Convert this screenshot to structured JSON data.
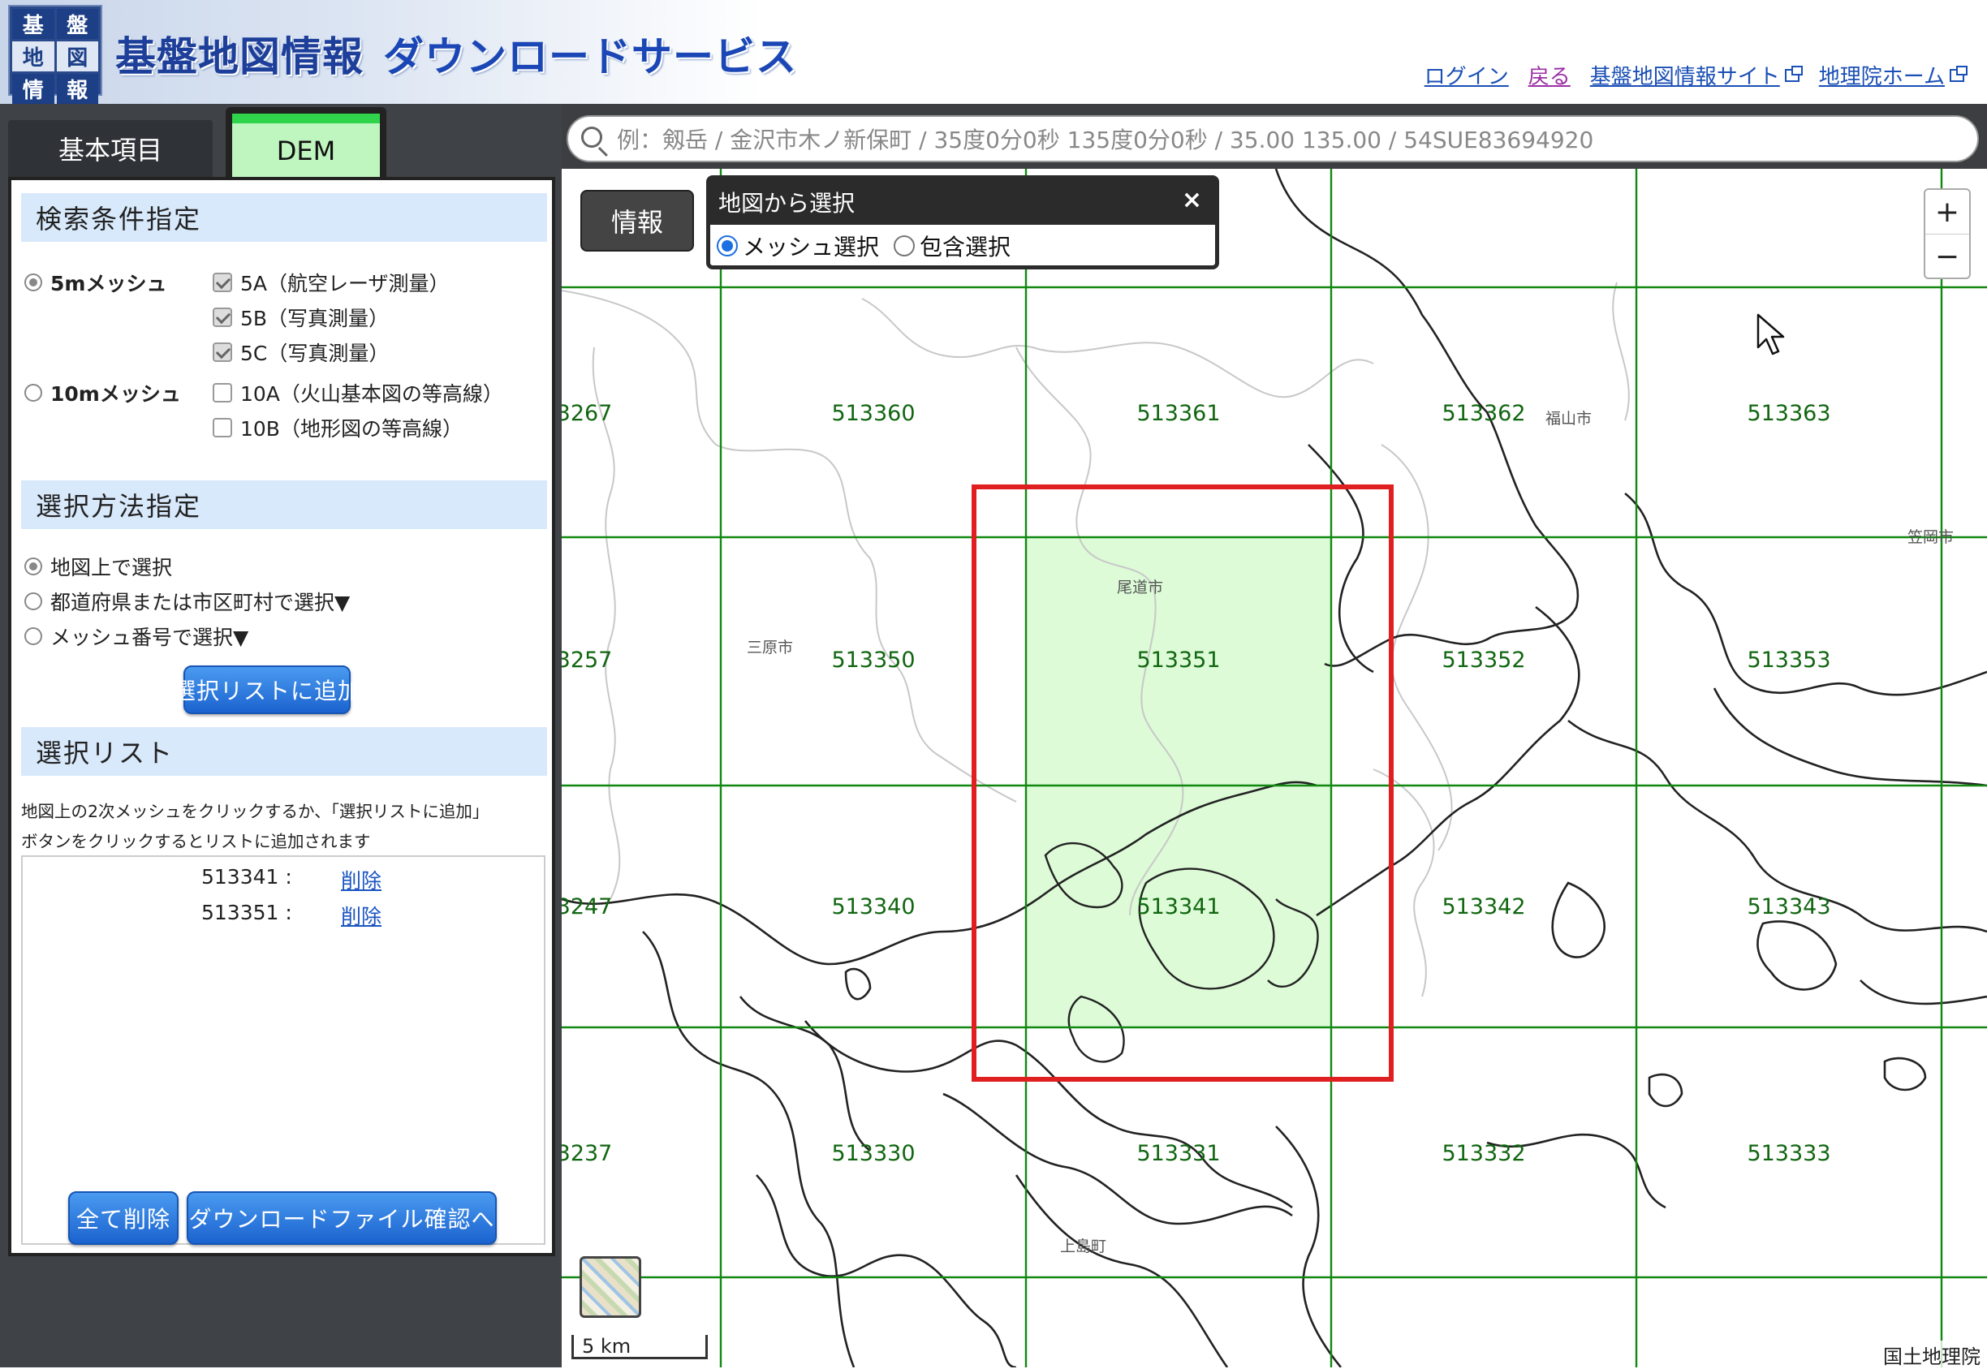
{
  "header": {
    "logo_chars": [
      "基",
      "盤",
      "地",
      "図",
      "情",
      "報"
    ],
    "title_main": "基盤地図情報",
    "title_sub": "ダウンロードサービス",
    "links": {
      "login": "ログイン",
      "back": "戻る",
      "site": "基盤地図情報サイト",
      "home": "地理院ホーム"
    }
  },
  "tabs": {
    "basic": "基本項目",
    "dem": "DEM"
  },
  "panel": {
    "search_conditions": {
      "heading": "検索条件指定",
      "mesh5": "5mメッシュ",
      "mesh10": "10mメッシュ",
      "options": [
        "5A（航空レーザ測量）",
        "5B（写真測量）",
        "5C（写真測量）",
        "10A（火山基本図の等高線）",
        "10B（地形図の等高線）"
      ]
    },
    "selection_method": {
      "heading": "選択方法指定",
      "options": [
        "地図上で選択",
        "都道府県または市区町村で選択▼",
        "メッシュ番号で選択▼"
      ],
      "add_button": "選択リストに追加"
    },
    "selection_list": {
      "heading": "選択リスト",
      "hint_line1": "地図上の2次メッシュをクリックするか、「選択リストに追加」",
      "hint_line2": "ボタンをクリックするとリストに追加されます",
      "items": [
        {
          "code": "513341 :",
          "delete": "削除"
        },
        {
          "code": "513351 :",
          "delete": "削除"
        }
      ],
      "delete_all": "全て削除",
      "confirm_download": "ダウンロードファイル確認へ"
    }
  },
  "map": {
    "search_placeholder": "例：剱岳 / 金沢市木ノ新保町 / 35度0分0秒 135度0分0秒 / 35.00 135.00 / 54SUE83694920",
    "info_button": "情報",
    "popup": {
      "title": "地図から選択",
      "close": "×",
      "mesh_select": "メッシュ選択",
      "contain_select": "包含選択"
    },
    "zoom_in": "+",
    "zoom_out": "−",
    "scale": "5 km",
    "attribution": "国土地理院",
    "mesh_labels": [
      "3267",
      "513360",
      "513361",
      "513362",
      "513363",
      "3257",
      "513350",
      "513351",
      "513352",
      "513353",
      "3247",
      "513340",
      "513341",
      "513342",
      "513343",
      "3237",
      "513330",
      "513331",
      "513332",
      "513333"
    ],
    "place_labels": {
      "fukuyama": "福山市",
      "onomichi": "尾道市",
      "mihara": "三原市",
      "kamijima": "上島町",
      "kasaoka": "笠岡市"
    }
  },
  "colors": {
    "grid": "#118811",
    "selection": "#e02020",
    "selected_fill": "#d8fbd2",
    "accent": "#1b63cf"
  }
}
